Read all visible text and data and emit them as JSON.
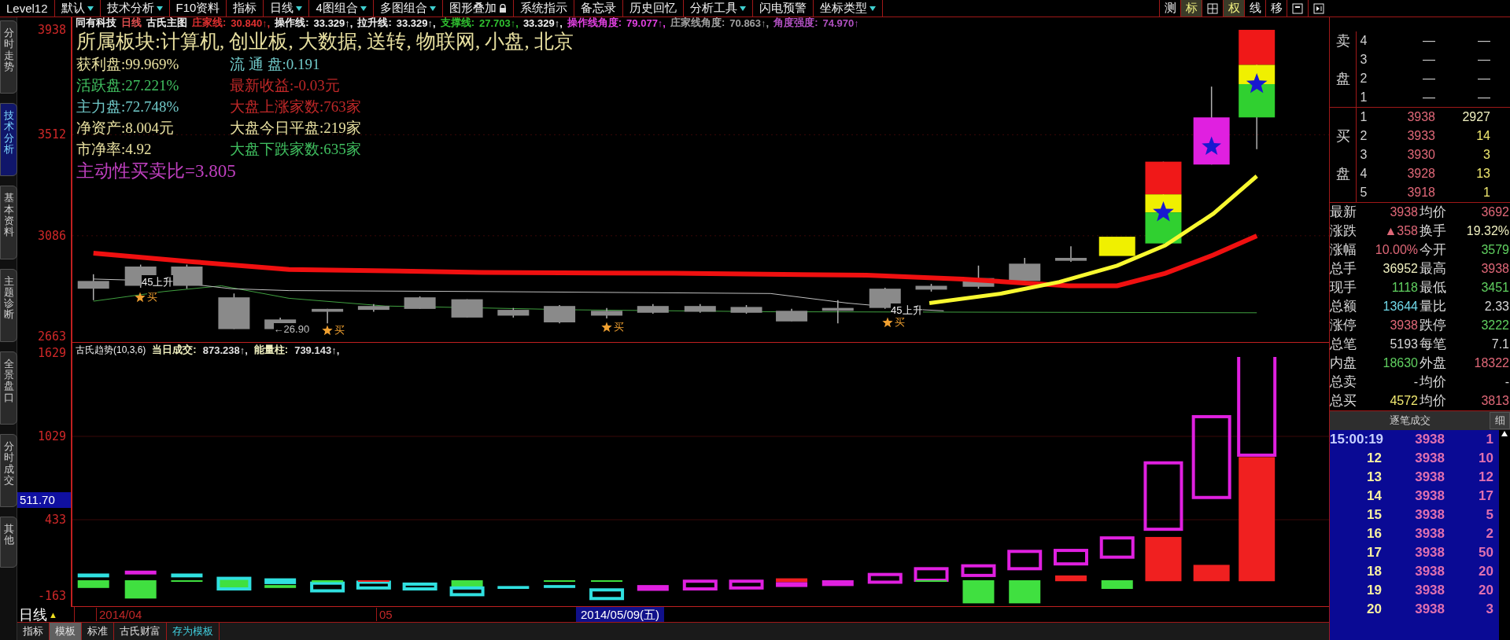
{
  "toolbar": {
    "items": [
      {
        "label": "Level12",
        "dropdown": false
      },
      {
        "label": "默认",
        "dropdown": true
      },
      {
        "label": "技术分析",
        "dropdown": true
      },
      {
        "label": "F10资料",
        "dropdown": false
      },
      {
        "label": "指标",
        "dropdown": false
      },
      {
        "label": "日线",
        "dropdown": true
      },
      {
        "label": "4图组合",
        "dropdown": true
      },
      {
        "label": "多图组合",
        "dropdown": true
      },
      {
        "label": "图形叠加",
        "dropdown": false,
        "lock": true
      },
      {
        "label": "系统指示",
        "dropdown": false
      },
      {
        "label": "备忘录",
        "dropdown": false
      },
      {
        "label": "历史回忆",
        "dropdown": false
      },
      {
        "label": "分析工具",
        "dropdown": true
      },
      {
        "label": "闪电预警",
        "dropdown": false
      },
      {
        "label": "坐标类型",
        "dropdown": true
      }
    ],
    "tools": [
      {
        "kind": "text",
        "label": "测",
        "selected": false
      },
      {
        "kind": "text",
        "label": "标",
        "selected": true
      },
      {
        "kind": "grid",
        "selected": false
      },
      {
        "kind": "text",
        "label": "权",
        "selected": true
      },
      {
        "kind": "text",
        "label": "线",
        "selected": false
      },
      {
        "kind": "text",
        "label": "移",
        "selected": false
      },
      {
        "kind": "window",
        "selected": false
      },
      {
        "kind": "end",
        "selected": false
      }
    ]
  },
  "side_tabs": [
    {
      "label": "分时走势",
      "selected": false
    },
    {
      "label": "技术分析",
      "selected": true
    },
    {
      "label": "基本资料",
      "selected": false
    },
    {
      "label": "主题诊断",
      "selected": false
    },
    {
      "label": "全景盘口",
      "selected": false
    },
    {
      "label": "分时成交",
      "selected": false
    },
    {
      "label": "其他",
      "selected": false
    }
  ],
  "chart_header": {
    "stock": "同有科技",
    "period": "日线",
    "template": "古氏主图",
    "indicators": [
      {
        "name": "庄家线:",
        "value": "30.840↑,",
        "color": "#e03030"
      },
      {
        "name": "操作线:",
        "value": "33.329↑,",
        "color": "#f0f0f0"
      },
      {
        "name": "拉升线:",
        "value": "33.329↑,",
        "color": "#f0f0f0"
      },
      {
        "name": "支撑线:",
        "value": "27.703↑,",
        "color": "#30c030"
      },
      {
        "value": "33.329↑,",
        "color": "#f0f0f0"
      },
      {
        "name": "操作线角度:",
        "value": "79.077↑,",
        "color": "#e040e0"
      },
      {
        "name": "庄家线角度:",
        "value": "70.863↑,",
        "color": "#a0a0a0"
      },
      {
        "name": "角度强度:",
        "value": "74.970↑",
        "color": "#b050c0"
      }
    ]
  },
  "price_axis": [
    "3938",
    "3512",
    "3086",
    "2663"
  ],
  "info": {
    "title": "所属板块:计算机, 创业板, 大数据, 送转, 物联网, 小盘, 北京",
    "lines": [
      {
        "text": "获利盘:99.969%",
        "color": "#e8e0a0"
      },
      {
        "text": "流 通 盘:0.191",
        "color": "#70c8c8"
      },
      {
        "text": "活跃盘:27.221%",
        "color": "#40c060"
      },
      {
        "text": "最新收益:-0.03元",
        "color": "#c02828"
      },
      {
        "text": "主力盘:72.748%",
        "color": "#70c8c8"
      },
      {
        "text": "大盘上涨家数:763家",
        "color": "#c02828"
      },
      {
        "text": "净资产:8.004元",
        "color": "#e8e0a0"
      },
      {
        "text": "大盘今日平盘:219家",
        "color": "#e8e0a0"
      },
      {
        "text": "市净率:4.92",
        "color": "#e8e0a0"
      },
      {
        "text": "大盘下跌家数:635家",
        "color": "#40c060"
      }
    ],
    "ratio": "主动性买卖比=3.805"
  },
  "annotations": [
    {
      "kind": "rise",
      "text": "45上升"
    },
    {
      "kind": "buy",
      "text": "买"
    },
    {
      "kind": "low",
      "text": "←26.90"
    },
    {
      "kind": "buy",
      "text": "买"
    },
    {
      "kind": "buy",
      "text": "买"
    },
    {
      "kind": "rise",
      "text": "45上升"
    },
    {
      "kind": "buy",
      "text": "买"
    }
  ],
  "volume": {
    "name": "古氏趋势(10,3,6)",
    "items": [
      {
        "label": "当日成交:",
        "value": "873.238↑,"
      },
      {
        "label": "能量柱:",
        "value": "739.143↑,"
      }
    ],
    "axis": [
      "1629",
      "1029",
      "433",
      "-163"
    ],
    "cursor_value": "511.70"
  },
  "date_axis": {
    "period": "日线",
    "marker": "▲",
    "dates": [
      "2014/04",
      "05"
    ],
    "cursor_date": "2014/05/09(五)"
  },
  "bottom_tabs": [
    {
      "label": "指标",
      "selected": false,
      "kind": "tab"
    },
    {
      "label": "模板",
      "selected": true,
      "kind": "tab"
    },
    {
      "label": "标准",
      "selected": false,
      "kind": "tab"
    },
    {
      "label": "古氏财富",
      "selected": false,
      "kind": "tab"
    },
    {
      "label": "存为模板",
      "selected": false,
      "kind": "action"
    }
  ],
  "order_book": {
    "sell": [
      {
        "side": "卖",
        "rank": "4",
        "price": "—",
        "volume": "—"
      },
      {
        "rank": "3",
        "price": "—",
        "volume": "—"
      },
      {
        "side": "盘",
        "rank": "2",
        "price": "—",
        "volume": "—"
      },
      {
        "rank": "1",
        "price": "—",
        "volume": "—"
      }
    ],
    "buy": [
      {
        "rank": "1",
        "price": "3938",
        "volume": "2927",
        "color": "#f0f0c0"
      },
      {
        "side": "买",
        "rank": "2",
        "price": "3933",
        "volume": "14",
        "color": "#f0e870"
      },
      {
        "rank": "3",
        "price": "3930",
        "volume": "3",
        "color": "#f0e870"
      },
      {
        "side": "盘",
        "rank": "4",
        "price": "3928",
        "volume": "13",
        "color": "#f0e870"
      },
      {
        "rank": "5",
        "price": "3918",
        "volume": "1",
        "color": "#f0e870"
      }
    ]
  },
  "stats": [
    [
      {
        "label": "最新",
        "value": "3938",
        "color": "#e06878"
      },
      {
        "label": "均价",
        "value": "3692",
        "color": "#e06878"
      }
    ],
    [
      {
        "label": "涨跌",
        "value": "▲358",
        "color": "#e06878"
      },
      {
        "label": "换手",
        "value": "19.32%",
        "color": "#f0f0c0"
      }
    ],
    [
      {
        "label": "涨幅",
        "value": "10.00%",
        "color": "#e06878"
      },
      {
        "label": "今开",
        "value": "3579",
        "color": "#60d060"
      }
    ],
    [
      {
        "label": "总手",
        "value": "36952",
        "color": "#f0f0c0"
      },
      {
        "label": "最高",
        "value": "3938",
        "color": "#e06878"
      }
    ],
    [
      {
        "label": "现手",
        "value": "1118",
        "color": "#60d060"
      },
      {
        "label": "最低",
        "value": "3451",
        "color": "#60d060"
      }
    ],
    [
      {
        "label": "总额",
        "value": "13644",
        "color": "#70d8e8"
      },
      {
        "label": "量比",
        "value": "2.33",
        "color": "#d8d8d8"
      }
    ],
    [
      {
        "label": "涨停",
        "value": "3938",
        "color": "#e06878"
      },
      {
        "label": "跌停",
        "value": "3222",
        "color": "#60d060"
      }
    ],
    [
      {
        "label": "总笔",
        "value": "5193",
        "color": "#d8d8d8"
      },
      {
        "label": "每笔",
        "value": "7.1",
        "color": "#d8d8d8"
      }
    ],
    [
      {
        "label": "内盘",
        "value": "18630",
        "color": "#60d060"
      },
      {
        "label": "外盘",
        "value": "18322",
        "color": "#e06878"
      }
    ],
    [
      {
        "label": "总卖",
        "value": "-",
        "color": "#d8d8d8"
      },
      {
        "label": "均价",
        "value": "-",
        "color": "#d8d8d8"
      }
    ],
    [
      {
        "label": "总买",
        "value": "4572",
        "color": "#f0e870"
      },
      {
        "label": "均价",
        "value": "3813",
        "color": "#e06878"
      }
    ]
  ],
  "ticks": {
    "title": "逐笔成交",
    "detail": "细",
    "rows": [
      {
        "kind": "minute",
        "time": "15:00:19",
        "price": "3938",
        "volume": "1"
      },
      {
        "kind": "second",
        "time": "12",
        "price": "3938",
        "volume": "10"
      },
      {
        "kind": "second",
        "time": "13",
        "price": "3938",
        "volume": "12"
      },
      {
        "kind": "second",
        "time": "14",
        "price": "3938",
        "volume": "17"
      },
      {
        "kind": "second",
        "time": "15",
        "price": "3938",
        "volume": "5"
      },
      {
        "kind": "second",
        "time": "16",
        "price": "3938",
        "volume": "2"
      },
      {
        "kind": "second",
        "time": "17",
        "price": "3938",
        "volume": "50"
      },
      {
        "kind": "second",
        "time": "18",
        "price": "3938",
        "volume": "20"
      },
      {
        "kind": "second",
        "time": "19",
        "price": "3938",
        "volume": "20"
      },
      {
        "kind": "second",
        "time": "20",
        "price": "3938",
        "volume": "3"
      }
    ]
  }
}
